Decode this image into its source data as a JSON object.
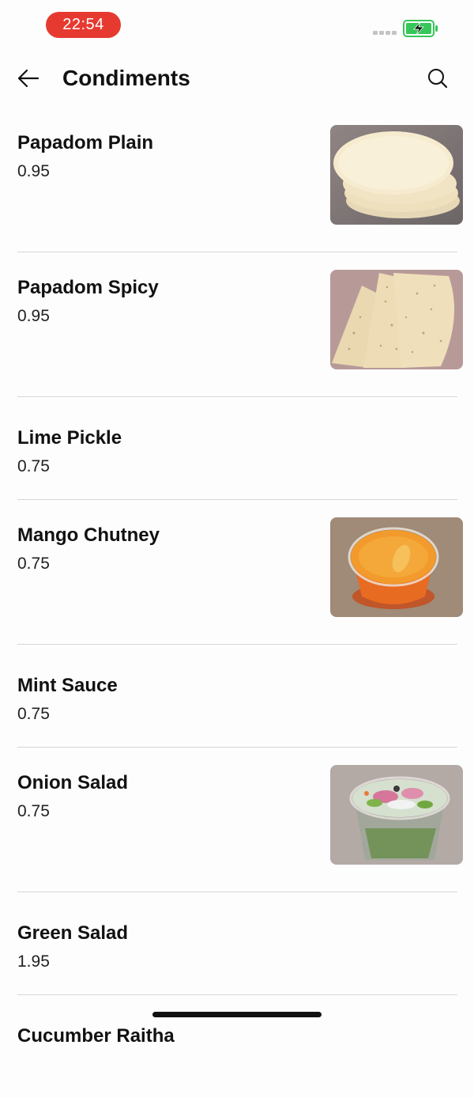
{
  "status_bar": {
    "time": "22:54",
    "time_pill_color": "#e63a30",
    "battery_state": "charging",
    "battery_color": "#35c759"
  },
  "header": {
    "back_icon": "arrow-left-icon",
    "title": "Condiments",
    "search_icon": "search-icon"
  },
  "items": [
    {
      "name": "Papadom Plain",
      "price": "0.95",
      "image": "papadom-plain-photo"
    },
    {
      "name": "Papadom Spicy",
      "price": "0.95",
      "image": "papadom-spicy-photo"
    },
    {
      "name": "Lime Pickle",
      "price": "0.75",
      "image": null
    },
    {
      "name": "Mango Chutney",
      "price": "0.75",
      "image": "mango-chutney-photo"
    },
    {
      "name": "Mint Sauce",
      "price": "0.75",
      "image": null
    },
    {
      "name": "Onion Salad",
      "price": "0.75",
      "image": "onion-salad-photo"
    },
    {
      "name": "Green Salad",
      "price": "1.95",
      "image": null
    },
    {
      "name": "Cucumber Raitha",
      "price": "",
      "image": null
    }
  ]
}
